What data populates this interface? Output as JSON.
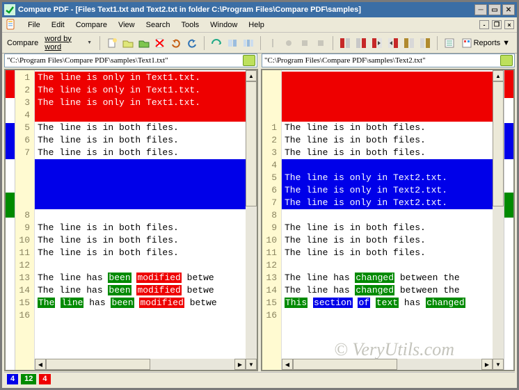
{
  "window": {
    "title": "Compare PDF - [Files Text1.txt and Text2.txt in folder C:\\Program Files\\Compare PDF\\samples]"
  },
  "menu": [
    "File",
    "Edit",
    "Compare",
    "View",
    "Search",
    "Tools",
    "Window",
    "Help"
  ],
  "toolbar": {
    "compare_label": "Compare",
    "compare_mode": "word by word",
    "reports_label": "Reports"
  },
  "files": {
    "left": {
      "path": "\"C:\\Program Files\\Compare PDF\\samples\\Text1.txt\""
    },
    "right": {
      "path": "\"C:\\Program Files\\Compare PDF\\samples\\Text2.txt\""
    }
  },
  "status": {
    "added": "4",
    "changed": "12",
    "deleted": "4"
  },
  "colors": {
    "deleted": "#ee0000",
    "added": "#0000e9",
    "changed": "#008a00"
  },
  "watermark": "© VeryUtils.com",
  "left_lines": [
    {
      "n": 1,
      "kind": "del",
      "segs": [
        {
          "t": "The line is only in Text1.txt."
        }
      ]
    },
    {
      "n": 2,
      "kind": "del",
      "segs": [
        {
          "t": "The line is only in Text1.txt."
        }
      ]
    },
    {
      "n": 3,
      "kind": "del",
      "segs": [
        {
          "t": "The line is only in Text1.txt."
        }
      ]
    },
    {
      "n": 4,
      "kind": "del",
      "segs": [
        {
          "t": ""
        }
      ]
    },
    {
      "n": 5,
      "segs": [
        {
          "t": "The line is in both files."
        }
      ]
    },
    {
      "n": 6,
      "segs": [
        {
          "t": "The line is in both files."
        }
      ]
    },
    {
      "n": 7,
      "segs": [
        {
          "t": "The line is in both files."
        }
      ]
    },
    {
      "n": null,
      "kind": "blueblock"
    },
    {
      "n": 8,
      "segs": [
        {
          "t": ""
        }
      ]
    },
    {
      "n": 9,
      "segs": [
        {
          "t": "The line is in both files."
        }
      ]
    },
    {
      "n": 10,
      "segs": [
        {
          "t": "The line is in both files."
        }
      ]
    },
    {
      "n": 11,
      "segs": [
        {
          "t": "The line is in both files."
        }
      ]
    },
    {
      "n": 12,
      "segs": [
        {
          "t": ""
        }
      ]
    },
    {
      "n": 13,
      "segs": [
        {
          "t": "The line has "
        },
        {
          "t": "been",
          "c": "green"
        },
        {
          "t": " "
        },
        {
          "t": "modified",
          "c": "red"
        },
        {
          "t": " betwe"
        }
      ]
    },
    {
      "n": 14,
      "segs": [
        {
          "t": "The line has "
        },
        {
          "t": "been",
          "c": "green"
        },
        {
          "t": " "
        },
        {
          "t": "modified",
          "c": "red"
        },
        {
          "t": " betwe"
        }
      ]
    },
    {
      "n": 15,
      "segs": [
        {
          "t": "The",
          "c": "green"
        },
        {
          "t": " "
        },
        {
          "t": "line",
          "c": "green"
        },
        {
          "t": " has "
        },
        {
          "t": "been",
          "c": "green"
        },
        {
          "t": " "
        },
        {
          "t": "modified",
          "c": "red"
        },
        {
          "t": " betwe"
        }
      ]
    },
    {
      "n": 16,
      "segs": [
        {
          "t": ""
        }
      ]
    }
  ],
  "right_lines": [
    {
      "n": null,
      "kind": "redblock"
    },
    {
      "n": 1,
      "segs": [
        {
          "t": "The line is in both files."
        }
      ]
    },
    {
      "n": 2,
      "segs": [
        {
          "t": "The line is in both files."
        }
      ]
    },
    {
      "n": 3,
      "segs": [
        {
          "t": "The line is in both files."
        }
      ]
    },
    {
      "n": 4,
      "kind": "add",
      "segs": [
        {
          "t": ""
        }
      ]
    },
    {
      "n": 5,
      "kind": "add",
      "segs": [
        {
          "t": "The line is only in Text2.txt."
        }
      ]
    },
    {
      "n": 6,
      "kind": "add",
      "segs": [
        {
          "t": "The line is only in Text2.txt."
        }
      ]
    },
    {
      "n": 7,
      "kind": "add",
      "segs": [
        {
          "t": "The line is only in Text2.txt."
        }
      ]
    },
    {
      "n": 8,
      "segs": [
        {
          "t": ""
        }
      ]
    },
    {
      "n": 9,
      "segs": [
        {
          "t": "The line is in both files."
        }
      ]
    },
    {
      "n": 10,
      "segs": [
        {
          "t": "The line is in both files."
        }
      ]
    },
    {
      "n": 11,
      "segs": [
        {
          "t": "The line is in both files."
        }
      ]
    },
    {
      "n": 12,
      "segs": [
        {
          "t": ""
        }
      ]
    },
    {
      "n": 13,
      "segs": [
        {
          "t": "The line has "
        },
        {
          "t": "changed",
          "c": "green"
        },
        {
          "t": " between the"
        }
      ]
    },
    {
      "n": 14,
      "segs": [
        {
          "t": "The line has "
        },
        {
          "t": "changed",
          "c": "green"
        },
        {
          "t": " between the"
        }
      ]
    },
    {
      "n": 15,
      "segs": [
        {
          "t": "This",
          "c": "green"
        },
        {
          "t": " "
        },
        {
          "t": "section",
          "c": "blue"
        },
        {
          "t": " "
        },
        {
          "t": "of",
          "c": "blue"
        },
        {
          "t": " "
        },
        {
          "t": "text",
          "c": "green"
        },
        {
          "t": " has "
        },
        {
          "t": "changed",
          "c": "green"
        }
      ]
    },
    {
      "n": 16,
      "segs": [
        {
          "t": ""
        }
      ]
    }
  ]
}
